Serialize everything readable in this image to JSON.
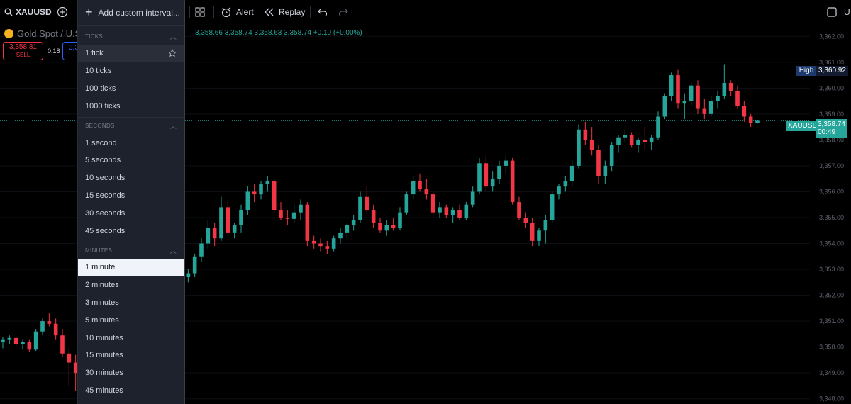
{
  "toolbar": {
    "symbol": "XAUUSD",
    "alert_label": "Alert",
    "replay_label": "Replay",
    "right_label": "U"
  },
  "legend": {
    "instrument": "Gold Spot / U.S.",
    "ohlc_text": "3,358.66  3,358.74  3,358.63  3,358.74  +0.10 (+0.00%)"
  },
  "trade": {
    "sell_price": "3,358.81",
    "sell_label": "SELL",
    "spread": "0.18",
    "buy_price": "3,3"
  },
  "price_labels": {
    "high_label": "High",
    "high_value": "3,360.92",
    "symbol_tag": "XAUUSD",
    "current_value": "3,358.74",
    "countdown": "00:49"
  },
  "colors": {
    "up": "#26a69a",
    "down": "#f23645",
    "high_bg": "#1c3a6e",
    "current_bg": "#26a69a",
    "dropdown_bg": "#1e222d"
  },
  "dropdown": {
    "add_custom_label": "Add custom interval...",
    "sections": [
      {
        "title": "TICKS",
        "items": [
          "1 tick",
          "10 ticks",
          "100 ticks",
          "1000 ticks"
        ]
      },
      {
        "title": "SECONDS",
        "items": [
          "1 second",
          "5 seconds",
          "10 seconds",
          "15 seconds",
          "30 seconds",
          "45 seconds"
        ]
      },
      {
        "title": "MINUTES",
        "items": [
          "1 minute",
          "2 minutes",
          "3 minutes",
          "5 minutes",
          "10 minutes",
          "15 minutes",
          "30 minutes",
          "45 minutes"
        ]
      }
    ],
    "selected": "1 minute"
  },
  "chart_data": {
    "type": "candlestick",
    "symbol": "XAUUSD",
    "y_axis_ticks": [
      "3,362.00",
      "3,361.00",
      "3,360.00",
      "3,359.00",
      "3,358.00",
      "3,357.00",
      "3,356.00",
      "3,355.00",
      "3,354.00",
      "3,353.00",
      "3,352.00",
      "3,351.00",
      "3,350.00",
      "3,349.00",
      "3,348.00"
    ],
    "ylim": [
      3347.8,
      3362.5
    ],
    "current_price": 3358.74,
    "high": 3360.92,
    "candles": [
      [
        3350.2,
        3350.4,
        3349.95,
        3350.3
      ],
      [
        3350.3,
        3350.45,
        3350.1,
        3350.35
      ],
      [
        3350.35,
        3350.4,
        3350.05,
        3350.1
      ],
      [
        3350.1,
        3350.3,
        3349.9,
        3350.2
      ],
      [
        3350.2,
        3350.3,
        3349.8,
        3349.9
      ],
      [
        3349.9,
        3350.7,
        3349.85,
        3350.6
      ],
      [
        3350.6,
        3351.1,
        3350.45,
        3351.0
      ],
      [
        3351.0,
        3351.3,
        3350.8,
        3350.9
      ],
      [
        3350.9,
        3351.1,
        3350.3,
        3350.45
      ],
      [
        3350.45,
        3350.7,
        3349.6,
        3349.75
      ],
      [
        3349.75,
        3349.95,
        3348.5,
        3349.4
      ],
      [
        3349.4,
        3349.7,
        3348.3,
        3349.0
      ],
      [
        3349.0,
        3349.6,
        3348.8,
        3349.4
      ],
      [
        3349.4,
        3349.6,
        3349.05,
        3349.1
      ],
      [
        3349.1,
        3349.35,
        3348.9,
        3349.2
      ],
      [
        3349.2,
        3349.3,
        3348.8,
        3348.95
      ],
      [
        3348.95,
        3349.4,
        3348.85,
        3349.2
      ],
      [
        3349.2,
        3349.5,
        3349.0,
        3349.05
      ],
      [
        3349.05,
        3350.3,
        3349.0,
        3350.2
      ],
      [
        3350.2,
        3351.3,
        3350.0,
        3351.1
      ],
      [
        3351.1,
        3351.4,
        3350.6,
        3350.8
      ],
      [
        3350.8,
        3351.5,
        3350.7,
        3351.4
      ],
      [
        3351.4,
        3352.2,
        3351.3,
        3352.0
      ],
      [
        3352.0,
        3352.6,
        3351.7,
        3352.4
      ],
      [
        3352.4,
        3353.8,
        3352.3,
        3353.1
      ],
      [
        3353.1,
        3353.3,
        3351.9,
        3352.1
      ],
      [
        3352.1,
        3352.7,
        3352.0,
        3352.5
      ],
      [
        3352.5,
        3352.9,
        3352.2,
        3352.7
      ],
      [
        3352.7,
        3353.0,
        3352.5,
        3352.85
      ],
      [
        3352.85,
        3353.6,
        3352.7,
        3353.5
      ],
      [
        3353.5,
        3354.2,
        3353.3,
        3354.0
      ],
      [
        3354.0,
        3354.9,
        3353.8,
        3354.6
      ],
      [
        3354.6,
        3354.8,
        3353.9,
        3354.2
      ],
      [
        3354.2,
        3355.8,
        3354.1,
        3355.4
      ],
      [
        3355.4,
        3355.6,
        3354.3,
        3354.4
      ],
      [
        3354.4,
        3354.8,
        3354.2,
        3354.7
      ],
      [
        3354.7,
        3355.5,
        3354.4,
        3355.3
      ],
      [
        3355.3,
        3356.2,
        3355.1,
        3356.0
      ],
      [
        3356.0,
        3356.3,
        3355.6,
        3355.9
      ],
      [
        3355.9,
        3356.4,
        3355.7,
        3356.3
      ],
      [
        3356.3,
        3356.6,
        3356.0,
        3356.4
      ],
      [
        3356.4,
        3356.5,
        3355.2,
        3355.3
      ],
      [
        3355.3,
        3355.6,
        3354.9,
        3355.0
      ],
      [
        3355.0,
        3355.3,
        3354.7,
        3354.95
      ],
      [
        3354.95,
        3355.5,
        3354.8,
        3355.2
      ],
      [
        3355.2,
        3355.7,
        3354.9,
        3355.5
      ],
      [
        3355.5,
        3355.6,
        3353.9,
        3354.1
      ],
      [
        3354.1,
        3354.3,
        3353.8,
        3354.0
      ],
      [
        3354.0,
        3354.2,
        3353.7,
        3353.9
      ],
      [
        3353.9,
        3354.1,
        3353.6,
        3353.8
      ],
      [
        3353.8,
        3354.3,
        3353.7,
        3354.2
      ],
      [
        3354.2,
        3354.6,
        3354.0,
        3354.4
      ],
      [
        3354.4,
        3354.8,
        3354.2,
        3354.7
      ],
      [
        3354.7,
        3355.1,
        3354.5,
        3354.9
      ],
      [
        3354.9,
        3356.0,
        3354.8,
        3355.8
      ],
      [
        3355.8,
        3356.2,
        3355.2,
        3355.3
      ],
      [
        3355.3,
        3355.5,
        3354.6,
        3354.8
      ],
      [
        3354.8,
        3355.0,
        3354.4,
        3354.5
      ],
      [
        3354.5,
        3354.9,
        3354.3,
        3354.7
      ],
      [
        3354.7,
        3355.0,
        3354.5,
        3354.6
      ],
      [
        3354.6,
        3355.4,
        3354.5,
        3355.2
      ],
      [
        3355.2,
        3356.0,
        3355.1,
        3355.9
      ],
      [
        3355.9,
        3356.6,
        3355.7,
        3356.4
      ],
      [
        3356.4,
        3356.7,
        3356.0,
        3356.1
      ],
      [
        3356.1,
        3356.5,
        3355.7,
        3355.9
      ],
      [
        3355.9,
        3356.0,
        3355.1,
        3355.2
      ],
      [
        3355.2,
        3355.6,
        3355.0,
        3355.4
      ],
      [
        3355.4,
        3355.5,
        3355.0,
        3355.1
      ],
      [
        3355.1,
        3355.4,
        3354.8,
        3355.3
      ],
      [
        3355.3,
        3355.5,
        3354.9,
        3355.0
      ],
      [
        3355.0,
        3355.6,
        3354.9,
        3355.5
      ],
      [
        3355.5,
        3356.2,
        3355.4,
        3356.0
      ],
      [
        3356.0,
        3357.3,
        3355.9,
        3357.1
      ],
      [
        3357.1,
        3357.4,
        3356.0,
        3356.2
      ],
      [
        3356.2,
        3356.8,
        3356.0,
        3356.5
      ],
      [
        3356.5,
        3357.2,
        3356.3,
        3357.0
      ],
      [
        3357.0,
        3357.4,
        3356.7,
        3357.2
      ],
      [
        3357.2,
        3357.3,
        3355.5,
        3355.6
      ],
      [
        3355.6,
        3355.8,
        3354.9,
        3355.0
      ],
      [
        3355.0,
        3355.2,
        3354.6,
        3354.8
      ],
      [
        3354.8,
        3355.0,
        3353.9,
        3354.1
      ],
      [
        3354.1,
        3354.6,
        3353.9,
        3354.5
      ],
      [
        3354.5,
        3355.1,
        3354.0,
        3354.9
      ],
      [
        3354.9,
        3356.0,
        3354.8,
        3355.9
      ],
      [
        3355.9,
        3356.3,
        3355.7,
        3356.2
      ],
      [
        3356.2,
        3356.6,
        3356.0,
        3356.4
      ],
      [
        3356.4,
        3357.2,
        3356.2,
        3357.0
      ],
      [
        3357.0,
        3358.6,
        3356.9,
        3358.4
      ],
      [
        3358.4,
        3358.7,
        3357.8,
        3358.0
      ],
      [
        3358.0,
        3358.5,
        3357.4,
        3357.6
      ],
      [
        3357.6,
        3357.8,
        3356.3,
        3356.6
      ],
      [
        3356.6,
        3357.2,
        3356.3,
        3357.0
      ],
      [
        3357.0,
        3357.9,
        3356.8,
        3357.8
      ],
      [
        3357.8,
        3358.2,
        3357.5,
        3358.1
      ],
      [
        3358.1,
        3358.4,
        3357.9,
        3358.2
      ],
      [
        3358.2,
        3358.3,
        3357.7,
        3357.8
      ],
      [
        3357.8,
        3358.1,
        3357.5,
        3358.0
      ],
      [
        3358.0,
        3358.5,
        3357.6,
        3357.9
      ],
      [
        3357.9,
        3358.2,
        3357.6,
        3358.1
      ],
      [
        3358.1,
        3359.1,
        3358.0,
        3358.9
      ],
      [
        3358.9,
        3359.8,
        3358.8,
        3359.7
      ],
      [
        3359.7,
        3360.6,
        3359.5,
        3360.5
      ],
      [
        3360.5,
        3360.7,
        3359.2,
        3359.4
      ],
      [
        3359.4,
        3359.8,
        3358.8,
        3359.5
      ],
      [
        3359.5,
        3360.2,
        3359.3,
        3360.1
      ],
      [
        3360.1,
        3360.3,
        3359.0,
        3359.2
      ],
      [
        3359.2,
        3359.6,
        3358.8,
        3359.0
      ],
      [
        3359.0,
        3359.7,
        3358.9,
        3359.5
      ],
      [
        3359.5,
        3359.9,
        3359.2,
        3359.7
      ],
      [
        3359.7,
        3360.9,
        3359.6,
        3360.2
      ],
      [
        3360.2,
        3360.3,
        3359.7,
        3359.9
      ],
      [
        3359.9,
        3360.1,
        3359.2,
        3359.3
      ],
      [
        3359.3,
        3359.5,
        3358.7,
        3358.9
      ],
      [
        3358.9,
        3359.0,
        3358.5,
        3358.65
      ],
      [
        3358.66,
        3358.74,
        3358.63,
        3358.74
      ]
    ]
  }
}
